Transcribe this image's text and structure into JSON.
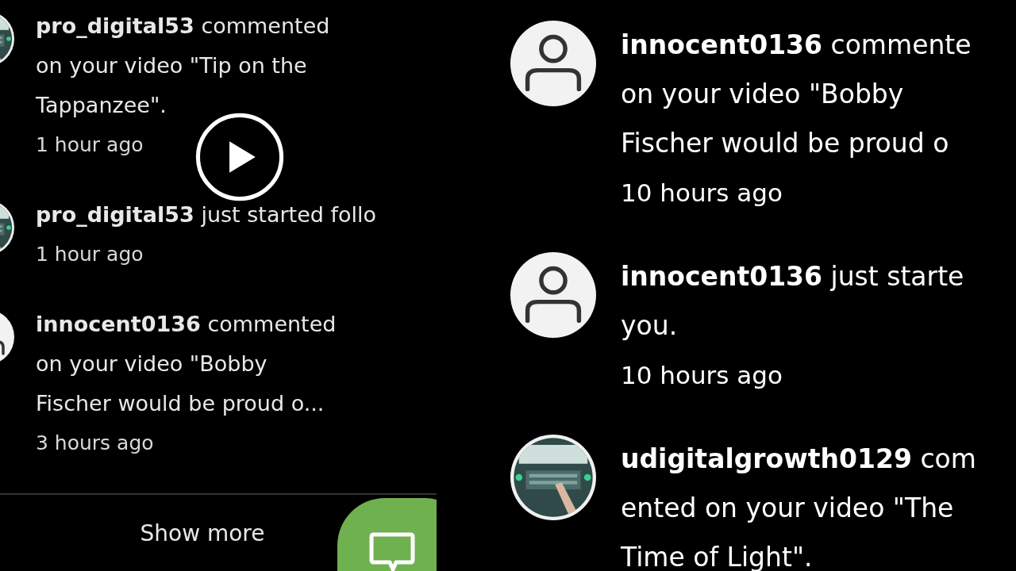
{
  "left_panel": {
    "notifications": [
      {
        "kind": "picture",
        "text_lines": [
          "**pro_digital53** commented",
          "on your video \"Tip on the",
          "Tappanzee\"."
        ],
        "time": "1 hour ago"
      },
      {
        "kind": "picture",
        "text_lines": [
          "**pro_digital53** just started follo"
        ],
        "time": "1 hour ago"
      },
      {
        "kind": "person",
        "text_lines": [
          "**innocent0136** commented",
          "on your video \"Bobby",
          "Fischer would be proud o..."
        ],
        "time": "3 hours ago"
      }
    ],
    "show_more": "Show more"
  },
  "right_panel": {
    "notifications": [
      {
        "kind": "person",
        "text_lines": [
          "**innocent0136** commente",
          "on your video \"Bobby",
          "Fischer would be proud o"
        ],
        "time": "10 hours ago"
      },
      {
        "kind": "person",
        "text_lines": [
          "**innocent0136** just starte",
          "you."
        ],
        "time": "10 hours ago"
      },
      {
        "kind": "picture",
        "text_lines": [
          "**udigitalgrowth0129** com",
          "ented on your video \"The",
          "Time of Light\"."
        ]
      }
    ]
  }
}
